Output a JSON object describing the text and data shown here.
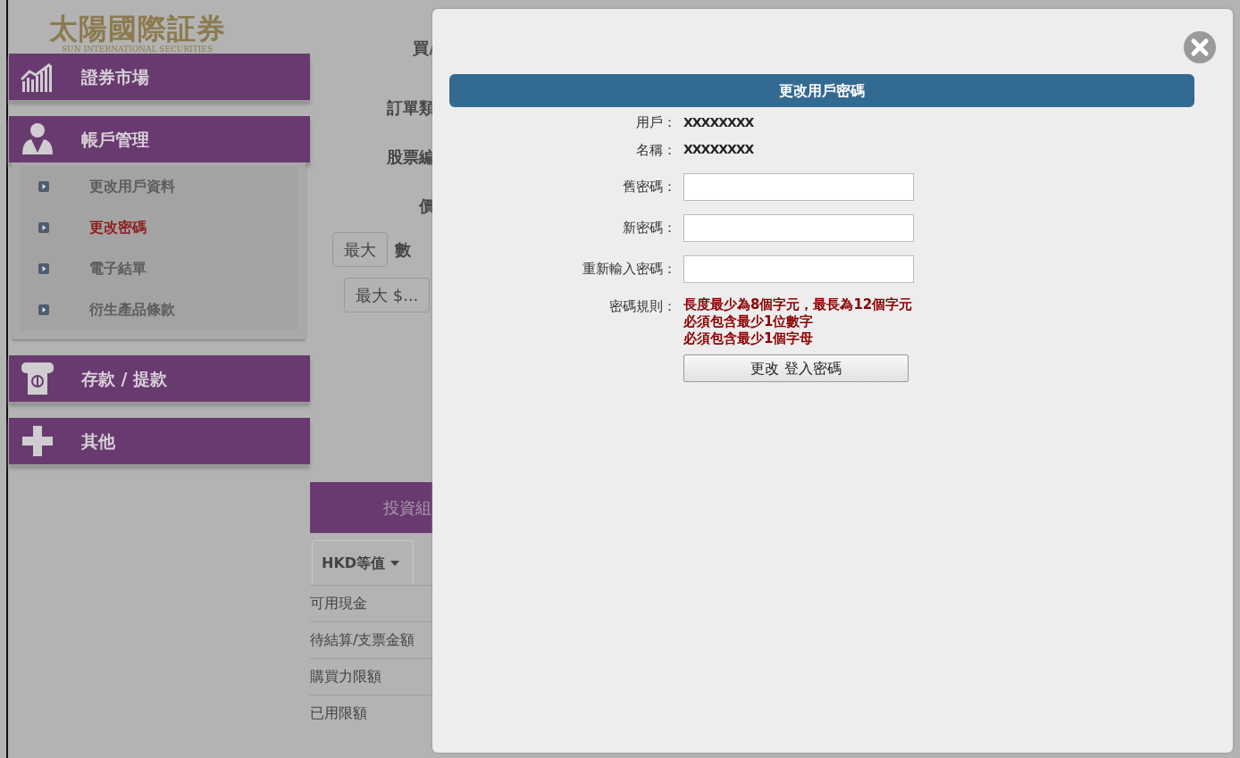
{
  "logo": {
    "name": "太陽國際証券",
    "subtitle": "SUN INTERNATIONAL SECURITIES"
  },
  "sidebar": {
    "sections": [
      {
        "label": "證券市場"
      },
      {
        "label": "帳戶管理",
        "items": [
          {
            "label": "更改用戶資料",
            "selected": false
          },
          {
            "label": "更改密碼",
            "selected": true
          },
          {
            "label": "電子結單",
            "selected": false
          },
          {
            "label": "衍生產品條款",
            "selected": false
          }
        ]
      },
      {
        "label": "存款 / 提款"
      },
      {
        "label": "其他"
      }
    ]
  },
  "order_form": {
    "labels": [
      "買/",
      "訂單類",
      "股票編",
      "價"
    ],
    "max_button": "最大",
    "quantity_label": "數",
    "amount_field": {
      "placeholder": "最大 $..."
    }
  },
  "portfolio": {
    "title": "投資組",
    "currency_dropdown": "HKD等值",
    "rows": [
      "可用現金",
      "待結算/支票金額",
      "購買力限額",
      "已用限額"
    ]
  },
  "modal": {
    "title": "更改用戶密碼",
    "fields": [
      {
        "kind": "text",
        "label": "用戶：",
        "value": "XXXXXXXX"
      },
      {
        "kind": "text",
        "label": "名稱：",
        "value": "XXXXXXXX"
      },
      {
        "kind": "input",
        "label": "舊密碼："
      },
      {
        "kind": "input",
        "label": "新密碼："
      },
      {
        "kind": "input",
        "label": "重新輸入密碼："
      }
    ],
    "rules_label": "密碼規則：",
    "rules": [
      "長度最少為8個字元，最長為12個字元",
      "必須包含最少1位數字",
      "必須包含最少1個字母"
    ],
    "submit": "更改 登入密碼"
  }
}
